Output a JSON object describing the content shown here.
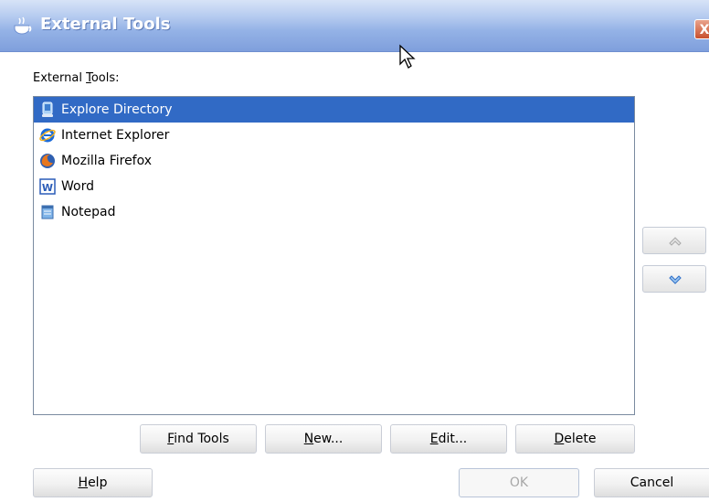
{
  "window": {
    "title": "External Tools",
    "close_glyph": "X"
  },
  "section_label": {
    "prefix": "External ",
    "mnemonic": "T",
    "suffix": "ools:"
  },
  "tools": [
    {
      "name": "Explore Directory",
      "icon": "explorer-icon",
      "selected": true
    },
    {
      "name": "Internet Explorer",
      "icon": "internet-explorer-icon",
      "selected": false
    },
    {
      "name": "Mozilla Firefox",
      "icon": "firefox-icon",
      "selected": false
    },
    {
      "name": "Word",
      "icon": "word-icon",
      "selected": false
    },
    {
      "name": "Notepad",
      "icon": "notepad-icon",
      "selected": false
    }
  ],
  "buttons": {
    "find_tools": {
      "mnemonic": "F",
      "rest": "ind Tools"
    },
    "new": {
      "mnemonic": "N",
      "rest": "ew..."
    },
    "edit": {
      "mnemonic": "E",
      "rest": "dit..."
    },
    "delete": {
      "mnemonic": "D",
      "rest": "elete"
    },
    "help": {
      "mnemonic": "H",
      "rest": "elp"
    },
    "ok": {
      "label": "OK"
    },
    "cancel": {
      "label": "Cancel"
    }
  },
  "colors": {
    "selection": "#316ac5",
    "titlebar": "#94b2e6"
  }
}
